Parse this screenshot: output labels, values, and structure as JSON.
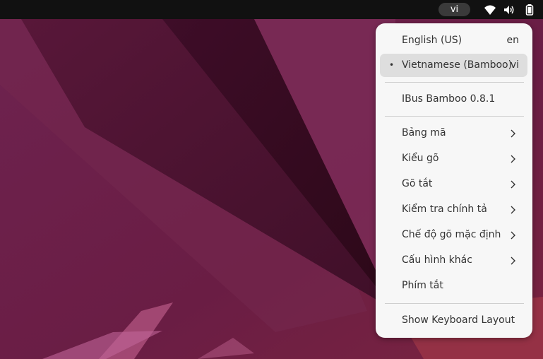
{
  "topbar": {
    "input_indicator": "vi",
    "tray_icons": [
      "wifi-icon",
      "volume-icon",
      "battery-icon"
    ]
  },
  "menu": {
    "layouts": [
      {
        "label": "English (US)",
        "short": "en",
        "active": false
      },
      {
        "label": "Vietnamese (Bamboo)",
        "short": "vi",
        "active": true
      }
    ],
    "engine_name": "IBus Bamboo 0.8.1",
    "submenus": [
      {
        "label": "Bảng mã",
        "has_submenu": true
      },
      {
        "label": "Kiểu gõ",
        "has_submenu": true
      },
      {
        "label": "Gõ tắt",
        "has_submenu": true
      },
      {
        "label": "Kiểm tra chính tả",
        "has_submenu": true
      },
      {
        "label": "Chế độ gõ mặc định",
        "has_submenu": true
      },
      {
        "label": "Cấu hình khác",
        "has_submenu": true
      },
      {
        "label": "Phím tắt",
        "has_submenu": false
      }
    ],
    "show_layout": "Show Keyboard Layout",
    "active_marker": "•"
  },
  "colors": {
    "topbar": "#111111",
    "menu_bg": "#f7f7f7",
    "active_item": "#dedede",
    "wallpaper": "#6b1f4a"
  }
}
